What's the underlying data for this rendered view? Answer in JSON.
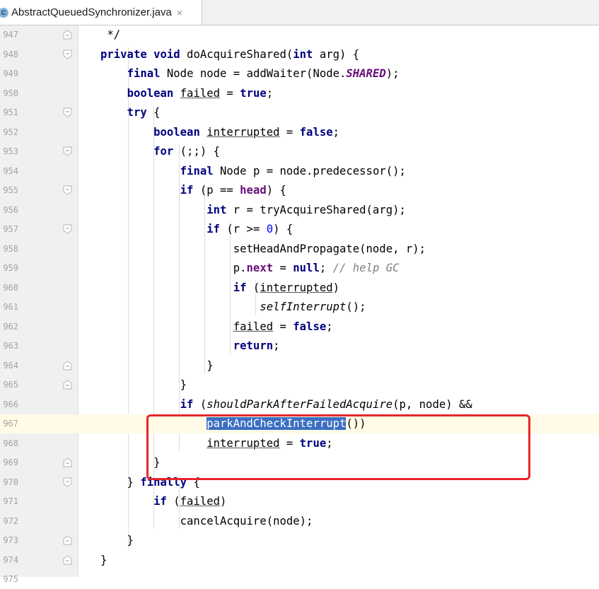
{
  "tab": {
    "icon_text": "C",
    "filename": "AbstractQueuedSynchronizer.java",
    "close_glyph": "×"
  },
  "lines": [
    {
      "n": "947",
      "code": " */",
      "fold": "end"
    },
    {
      "n": "948",
      "code": "private void doAcquireShared(int arg) {",
      "fold": "start"
    },
    {
      "n": "949",
      "code": "    final Node node = addWaiter(Node.SHARED);",
      "fold": ""
    },
    {
      "n": "950",
      "code": "    boolean failed = true;",
      "fold": ""
    },
    {
      "n": "951",
      "code": "    try {",
      "fold": "start"
    },
    {
      "n": "952",
      "code": "        boolean interrupted = false;",
      "fold": ""
    },
    {
      "n": "953",
      "code": "        for (;;) {",
      "fold": "start"
    },
    {
      "n": "954",
      "code": "            final Node p = node.predecessor();",
      "fold": ""
    },
    {
      "n": "955",
      "code": "            if (p == head) {",
      "fold": "start"
    },
    {
      "n": "956",
      "code": "                int r = tryAcquireShared(arg);",
      "fold": ""
    },
    {
      "n": "957",
      "code": "                if (r >= 0) {",
      "fold": "start"
    },
    {
      "n": "958",
      "code": "                    setHeadAndPropagate(node, r);",
      "fold": ""
    },
    {
      "n": "959",
      "code": "                    p.next = null; // help GC",
      "fold": ""
    },
    {
      "n": "960",
      "code": "                    if (interrupted)",
      "fold": ""
    },
    {
      "n": "961",
      "code": "                        selfInterrupt();",
      "fold": ""
    },
    {
      "n": "962",
      "code": "                    failed = false;",
      "fold": ""
    },
    {
      "n": "963",
      "code": "                    return;",
      "fold": ""
    },
    {
      "n": "964",
      "code": "                }",
      "fold": "end"
    },
    {
      "n": "965",
      "code": "            }",
      "fold": "end"
    },
    {
      "n": "966",
      "code": "            if (shouldParkAfterFailedAcquire(p, node) &&",
      "fold": ""
    },
    {
      "n": "967",
      "code": "                parkAndCheckInterrupt())",
      "fold": ""
    },
    {
      "n": "968",
      "code": "                interrupted = true;",
      "fold": ""
    },
    {
      "n": "969",
      "code": "        }",
      "fold": "end"
    },
    {
      "n": "970",
      "code": "    } finally {",
      "fold": "start"
    },
    {
      "n": "971",
      "code": "        if (failed)",
      "fold": ""
    },
    {
      "n": "972",
      "code": "            cancelAcquire(node);",
      "fold": ""
    },
    {
      "n": "973",
      "code": "    }",
      "fold": "end"
    },
    {
      "n": "974",
      "code": "}",
      "fold": "end"
    },
    {
      "n": "975",
      "code": "",
      "fold": ""
    }
  ],
  "current_line": "967",
  "selected_text": "parkAndCheckInterrupt",
  "colors": {
    "keyword": "#000080",
    "static_field": "#660e7a",
    "comment": "#808080",
    "number": "#0000ff",
    "selection": "#3a6ec3",
    "annotation_box": "#e8262b"
  }
}
